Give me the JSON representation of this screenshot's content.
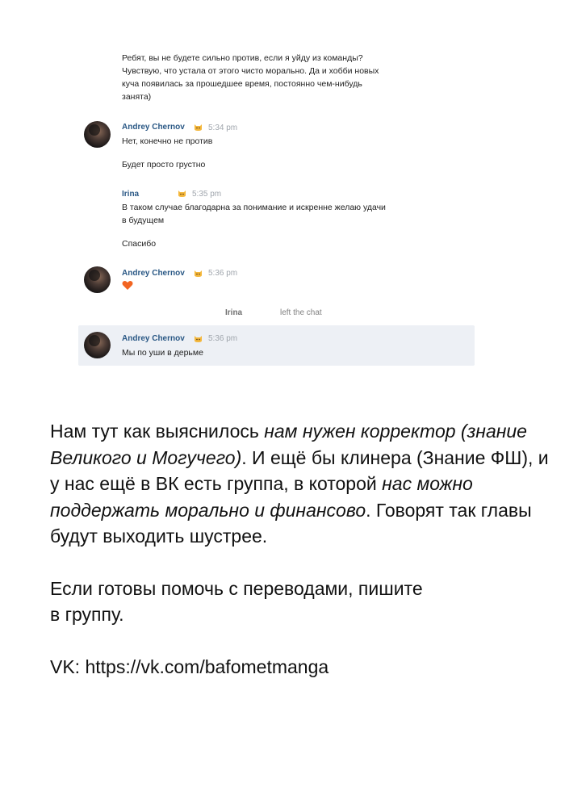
{
  "chat": {
    "intro_message": [
      "Ребят, вы не будете сильно против, если я уйду из команды?",
      "Чувствую, что устала от этого чисто морально. Да и хобби новых",
      "куча появилась за прошедшее время, постоянно чем-нибудь",
      "занята)"
    ],
    "messages": [
      {
        "author": "Andrey Chernov",
        "time": "5:34 pm",
        "lines": [
          "Нет, конечно не против",
          "",
          "Будет просто грустно"
        ]
      },
      {
        "author": "Irina",
        "time": "5:35 pm",
        "lines": [
          "В таком случае благодарна за понимание и искренне желаю удачи",
          "в будущем",
          "",
          "Спасибо"
        ]
      },
      {
        "author": "Andrey Chernov",
        "time": "5:36 pm",
        "emoji": "heart-icon"
      },
      {
        "author": "Andrey Chernov",
        "time": "5:36 pm",
        "lines": [
          "Мы по уши в дерьме"
        ]
      }
    ],
    "service": {
      "name": "Irina",
      "action": "left the chat"
    },
    "accent_color": "#2a5885",
    "highlight_color": "#edf0f5",
    "heart_color": "#f26522"
  },
  "notice": {
    "p1_a": "Нам тут как выяснилось ",
    "p1_b": "нам нужен корректор (знание Великого и Могучего)",
    "p1_c": ". И ещё бы клинера (Знание ФШ), и у нас ещё в ВК есть группа, в которой ",
    "p1_d": "нас можно поддержать морально и финансово",
    "p1_e": ". Говорят так главы будут выходить шустрее.",
    "p2": "Если готовы помочь с переводами, пишите в группу.",
    "p3": "VK: https://vk.com/bafometmanga"
  }
}
